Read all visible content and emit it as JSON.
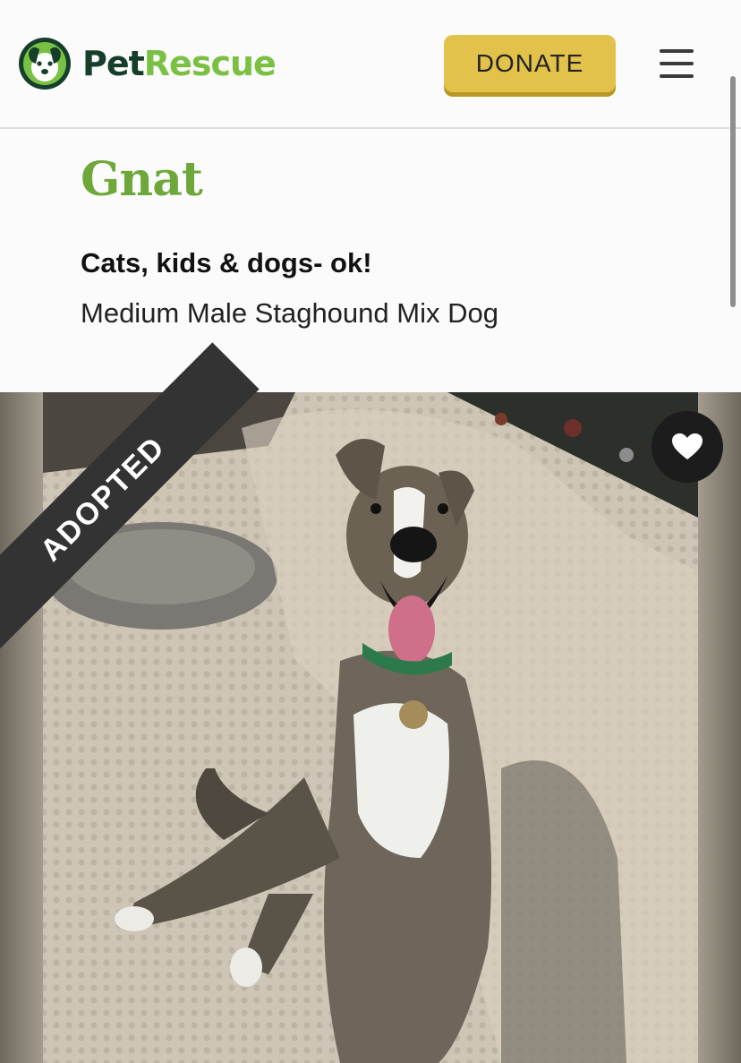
{
  "header": {
    "brand_part1": "Pet",
    "brand_part2": "Rescue",
    "donate_label": "DONATE"
  },
  "pet": {
    "name": "Gnat",
    "tagline": "Cats, kids & dogs- ok!",
    "description": "Medium Male Staghound Mix Dog",
    "status_label": "ADOPTED"
  },
  "icons": [
    "petrescue-logo-icon",
    "hamburger-menu-icon",
    "heart-icon"
  ],
  "colors": {
    "brand_dark": "#153f2b",
    "brand_green": "#7ac143",
    "name_green": "#6fa83a",
    "donate_yellow": "#e3c24b",
    "ribbon": "#333333"
  }
}
